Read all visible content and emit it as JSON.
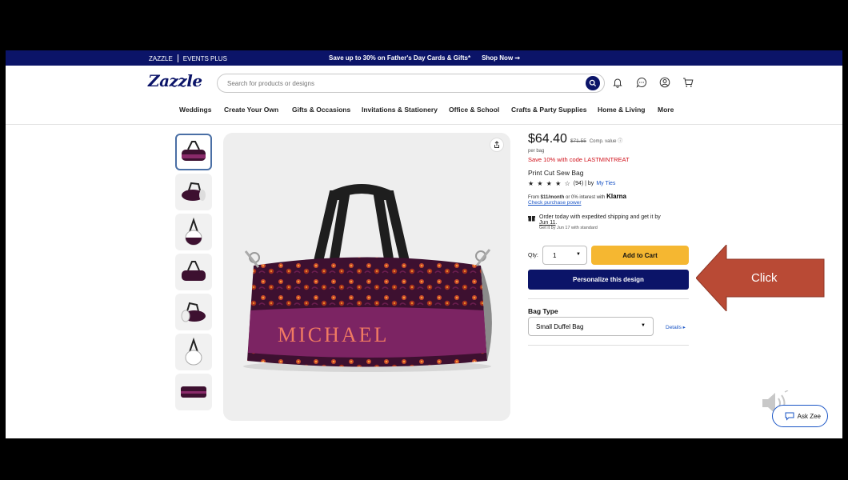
{
  "promo_bar": {
    "brand": "ZAZZLE",
    "events_plus": "EVENTS PLUS",
    "message": "Save up to 30% on Father's Day Cards & Gifts*",
    "cta": "Shop Now ➞"
  },
  "header": {
    "logo": "Zazzle",
    "search_placeholder": "Search for products or designs"
  },
  "nav": {
    "items": [
      "Weddings",
      "Create Your Own",
      "Gifts & Occasions",
      "Invitations & Stationery",
      "Office & School",
      "Crafts & Party Supplies",
      "Home & Living",
      "More"
    ]
  },
  "product": {
    "bag_text": "MICHAEL",
    "price": "$64.40",
    "old_price": "$71.55",
    "comp_value": "Comp. value ⓘ",
    "per_unit": "per bag",
    "promo": "Save 10% with code LASTMINTREAT",
    "title": "Print Cut Sew Bag",
    "stars": "★ ★ ★ ★ ☆",
    "reviews": "(94) | by",
    "seller": "My Ties",
    "klarna_prefix": "From",
    "klarna_amount": "$11/month",
    "klarna_suffix": "or 0% interest with",
    "klarna_brand": "Klarna",
    "purchase_power": "Check purchase power",
    "ship_text": "Order today with expedited shipping and get it by",
    "ship_date": "Jun 11",
    "ship_period": ".",
    "ship_standard": "Get it by Jun 17 with standard",
    "qty_label": "Qty:",
    "qty_value": "1",
    "add_to_cart": "Add to Cart",
    "personalize": "Personalize this design",
    "bag_type_label": "Bag Type",
    "bag_type_value": "Small Duffel Bag",
    "details": "Details ▸"
  },
  "annotation": {
    "label": "Click",
    "color": "#b94a35"
  },
  "assistant": {
    "label": "Ask Zee"
  },
  "colors": {
    "brand_navy": "#0b1468",
    "cta_yellow": "#f5b731",
    "promo_red": "#d0111b",
    "link_blue": "#1a55c6",
    "bag_purple": "#7c2463",
    "bag_name_color": "#f07a62"
  }
}
